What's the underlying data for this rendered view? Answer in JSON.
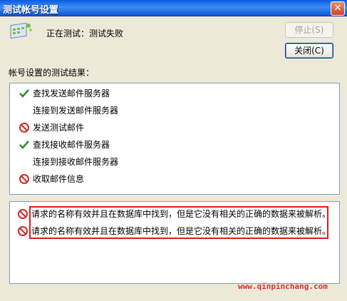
{
  "window": {
    "title": "测试帐号设置",
    "close_glyph": "✕"
  },
  "status": {
    "text": "正在测试：测试失败"
  },
  "buttons": {
    "stop": "停止(S)",
    "close": "关闭(C)"
  },
  "results": {
    "label": "帐号设置的测试结果：",
    "steps": [
      {
        "text": "查找发送邮件服务器",
        "state": "success",
        "icon": "check-icon"
      },
      {
        "text": "连接到发送邮件服务器",
        "state": "none",
        "icon": ""
      },
      {
        "text": "发送测试邮件",
        "state": "error",
        "icon": "prohibit-icon"
      },
      {
        "text": "查找接收邮件服务器",
        "state": "success",
        "icon": "check-icon"
      },
      {
        "text": "连接到接收邮件服务器",
        "state": "none",
        "icon": ""
      },
      {
        "text": "收取邮件信息",
        "state": "error",
        "icon": "prohibit-icon"
      }
    ]
  },
  "errors": {
    "items": [
      {
        "text": "请求的名称有效并且在数据库中找到，但是它没有相关的正确的数据来被解析。",
        "icon": "prohibit-icon"
      },
      {
        "text": "请求的名称有效并且在数据库中找到，但是它没有相关的正确的数据来被解析。",
        "icon": "prohibit-icon"
      }
    ],
    "highlight_color": "#e0191f"
  },
  "watermark": "www.qinpinchang.com",
  "colors": {
    "success": "#2e8b2e",
    "error": "#d22a2a",
    "titlebar": "#0a5be0"
  }
}
